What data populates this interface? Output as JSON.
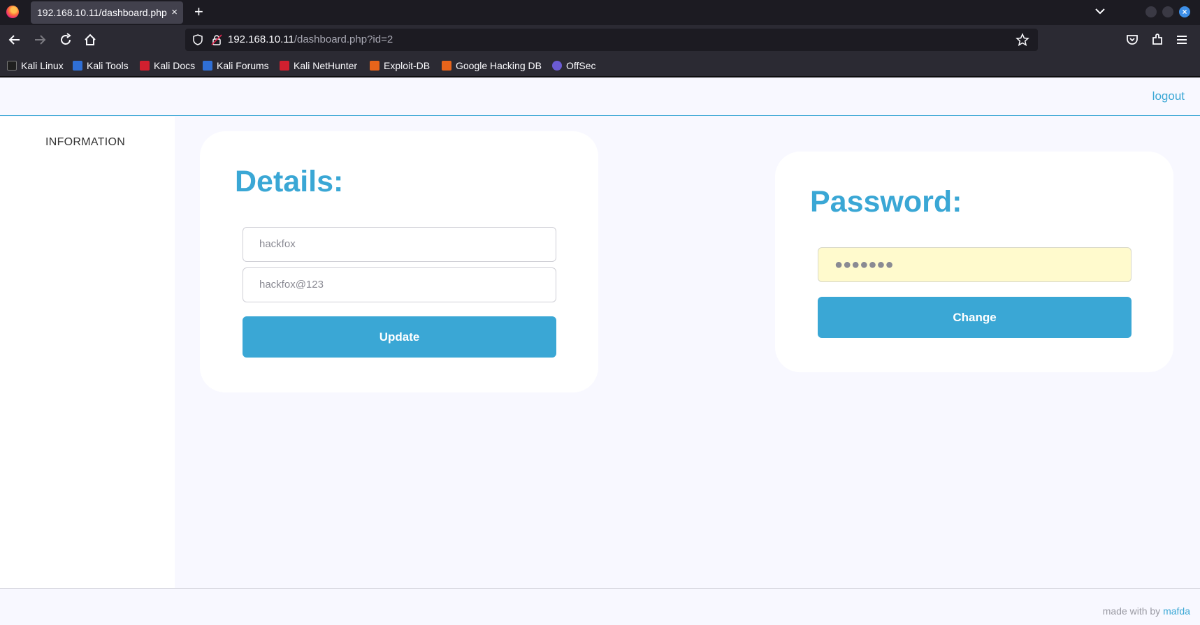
{
  "browser": {
    "tab_title": "192.168.10.11/dashboard.php",
    "tab_close": "×",
    "new_tab": "+",
    "url_host": "192.168.10.11",
    "url_path": "/dashboard.php?id=2",
    "window_close": "×",
    "bookmarks": [
      {
        "label": "Kali Linux",
        "color": "#1f1f1f"
      },
      {
        "label": "Kali Tools",
        "color": "#2f6fd6"
      },
      {
        "label": "Kali Docs",
        "color": "#d1202f"
      },
      {
        "label": "Kali Forums",
        "color": "#2f6fd6"
      },
      {
        "label": "Kali NetHunter",
        "color": "#d1202f"
      },
      {
        "label": "Exploit-DB",
        "color": "#e8641b"
      },
      {
        "label": "Google Hacking DB",
        "color": "#e8641b"
      },
      {
        "label": "OffSec",
        "color": "#6b5bd2"
      }
    ]
  },
  "header": {
    "logout_label": "logout"
  },
  "sidebar": {
    "items": [
      {
        "label": "INFORMATION"
      }
    ]
  },
  "details": {
    "title": "Details:",
    "username_value": "hackfox",
    "password_value": "hackfox@123",
    "update_label": "Update"
  },
  "password": {
    "title": "Password:",
    "masked_value": "●●●●●●●",
    "change_label": "Change"
  },
  "footer": {
    "prefix": "made with by",
    "author": "mafda"
  },
  "colors": {
    "accent": "#3aa7d5",
    "page_bg": "#f8f8ff",
    "autofill_bg": "#fffacd"
  }
}
